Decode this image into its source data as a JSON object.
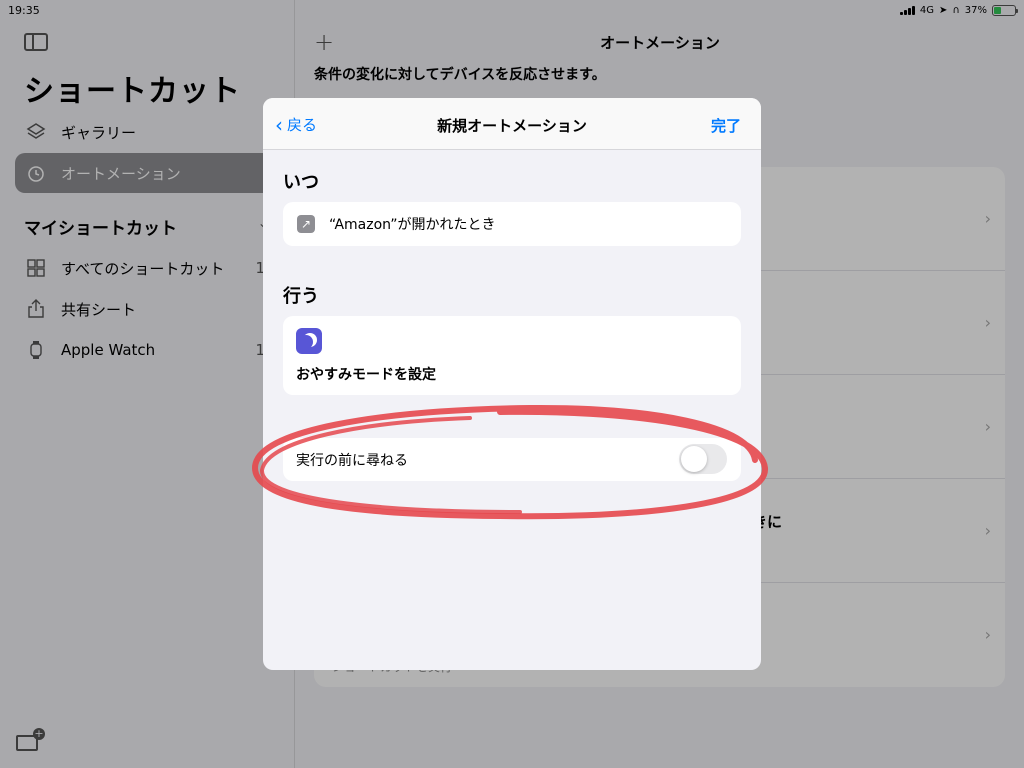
{
  "status_bar": {
    "time": "19:35",
    "network": "4G",
    "battery_percent": "37%",
    "battery_level": 0.37
  },
  "sidebar": {
    "title": "ショートカット",
    "items": [
      {
        "label": "ギャラリー",
        "icon": "layers-icon"
      },
      {
        "label": "オートメーション",
        "icon": "clock-icon",
        "selected": true
      }
    ],
    "section_title": "マイショートカット",
    "my_items": [
      {
        "label": "すべてのショートカット",
        "icon": "grid-icon",
        "count": "1"
      },
      {
        "label": "共有シート",
        "icon": "share-icon",
        "count": ""
      },
      {
        "label": "Apple Watch",
        "icon": "watch-icon",
        "count": "1"
      }
    ]
  },
  "main": {
    "title": "オートメーション",
    "subtitle": "条件の変化に対してデバイスを反応させます。",
    "row_fragment": "ときに",
    "row_fragment_sub": "ショートカットを実行"
  },
  "modal": {
    "back_label": "戻る",
    "title": "新規オートメーション",
    "done_label": "完了",
    "when_label": "いつ",
    "trigger_text": "“Amazon”が開かれたとき",
    "do_label": "行う",
    "action_text": "おやすみモードを設定",
    "ask_label": "実行の前に尋ねる",
    "ask_enabled": false
  },
  "colors": {
    "accent": "#007aff",
    "focus_purple": "#5856d6",
    "annotation_red": "#e5484d"
  }
}
